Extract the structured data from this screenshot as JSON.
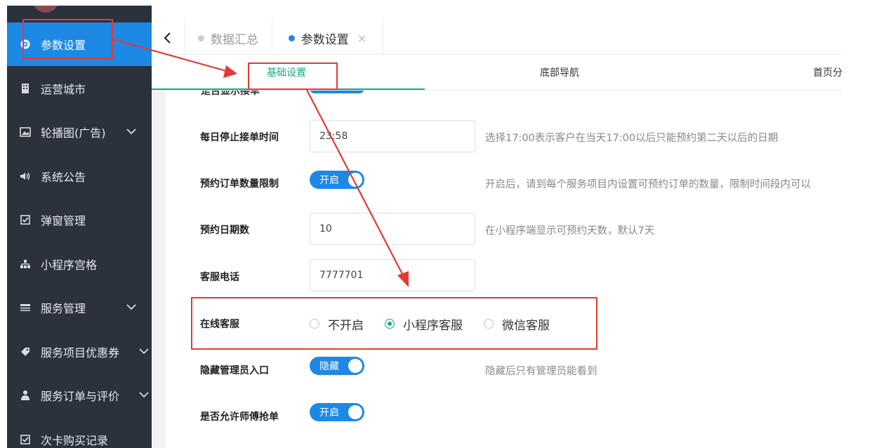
{
  "sidebar": {
    "items": [
      {
        "label": "参数设置",
        "icon": "gear-icon",
        "active": true
      },
      {
        "label": "运营城市",
        "icon": "building-icon"
      },
      {
        "label": "轮播图(广告)",
        "icon": "image-icon",
        "expandable": true
      },
      {
        "label": "系统公告",
        "icon": "speaker-icon"
      },
      {
        "label": "弹窗管理",
        "icon": "checkbox-icon"
      },
      {
        "label": "小程序宫格",
        "icon": "sitemap-icon"
      },
      {
        "label": "服务管理",
        "icon": "list-icon",
        "expandable": true
      },
      {
        "label": "服务项目优惠券",
        "icon": "tag-icon",
        "expandable": true
      },
      {
        "label": "服务订单与评价",
        "icon": "user-icon",
        "expandable": true
      },
      {
        "label": "次卡购买记录",
        "icon": "checkbox-icon"
      }
    ]
  },
  "tabs": [
    {
      "label": "数据汇总",
      "dot_color": "#cccccc"
    },
    {
      "label": "参数设置",
      "dot_color": "#1e88e5",
      "closable": true,
      "close_glyph": "×"
    }
  ],
  "subtabs": [
    {
      "label": "基础设置",
      "active": true
    },
    {
      "label": "底部导航"
    },
    {
      "label": "首页分"
    }
  ],
  "form": {
    "partial_label": "是否显示接单",
    "stop_time": {
      "label": "每日停止接单时间",
      "value": "23:58",
      "hint": "选择17:00表示客户在当天17:00以后只能预约第二天以后的日期"
    },
    "order_limit": {
      "label": "预约订单数量限制",
      "switch": "开启",
      "hint": "开启后，请到每个服务项目内设置可预约订单的数量，限制时间段内可以"
    },
    "days": {
      "label": "预约日期数",
      "value": "10",
      "hint": "在小程序端显示可预约天数，默认7天"
    },
    "phone": {
      "label": "客服电话",
      "value": "7777701"
    },
    "online_service": {
      "label": "在线客服",
      "options": [
        "不开启",
        "小程序客服",
        "微信客服"
      ],
      "selected": "小程序客服"
    },
    "hide_admin": {
      "label": "隐藏管理员入口",
      "switch": "隐藏",
      "hint": "隐藏后只有管理员能看到"
    },
    "grab_order": {
      "label": "是否允许师傅抢单",
      "switch": "开启"
    }
  },
  "colors": {
    "sidebar_bg": "#2b323c",
    "accent": "#1e88e5",
    "active_green": "#1ba784",
    "annotation_red": "#e53935"
  }
}
